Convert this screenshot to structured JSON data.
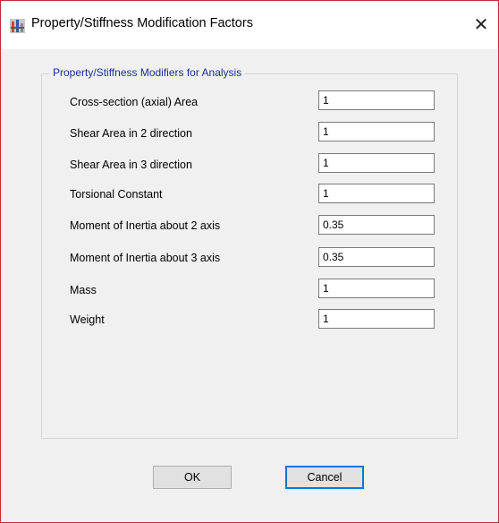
{
  "window": {
    "title": "Property/Stiffness Modification Factors",
    "close_glyph": "✕",
    "app_icon": "etabs-app-icon",
    "border_color": "#c42b34"
  },
  "group": {
    "title": "Property/Stiffness Modifiers for Analysis",
    "title_color": "#1a2f8f"
  },
  "rows": [
    {
      "label": "Cross-section (axial) Area",
      "value": "1"
    },
    {
      "label": "Shear Area in 2 direction",
      "value": "1"
    },
    {
      "label": "Shear Area in 3 direction",
      "value": "1"
    },
    {
      "label": "Torsional Constant",
      "value": "1"
    },
    {
      "label": "Moment of Inertia about 2 axis",
      "value": "0.35"
    },
    {
      "label": "Moment of Inertia about 3 axis",
      "value": "0.35"
    },
    {
      "label": "Mass",
      "value": "1"
    },
    {
      "label": "Weight",
      "value": "1"
    }
  ],
  "buttons": {
    "ok": "OK",
    "cancel": "Cancel",
    "focus_color": "#0078d7"
  }
}
